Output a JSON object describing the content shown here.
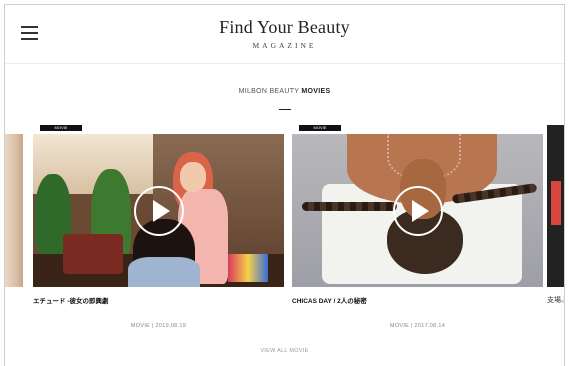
{
  "header": {
    "brand_title": "Find Your Beauty",
    "brand_subtitle": "MAGAZINE"
  },
  "section": {
    "title_light": "MILBON BEAUTY",
    "title_bold": "MOVIES"
  },
  "cards": [
    {
      "badge": "MOVIE",
      "title": "エチュード -彼女の即興劇",
      "meta": "MOVIE | 2019.08.19"
    },
    {
      "badge": "MOVIE",
      "title": "CHICAS DAY / 2人の秘密",
      "meta": "MOVIE | 2017.08.14"
    }
  ],
  "peek_right_caption": "支場ふ",
  "view_all": "VIEW ALL MOVIE",
  "colors": {
    "accent_black": "#111111",
    "text_gray": "#888888"
  },
  "icons": {
    "menu": "hamburger-menu-icon",
    "play": "play-icon"
  }
}
